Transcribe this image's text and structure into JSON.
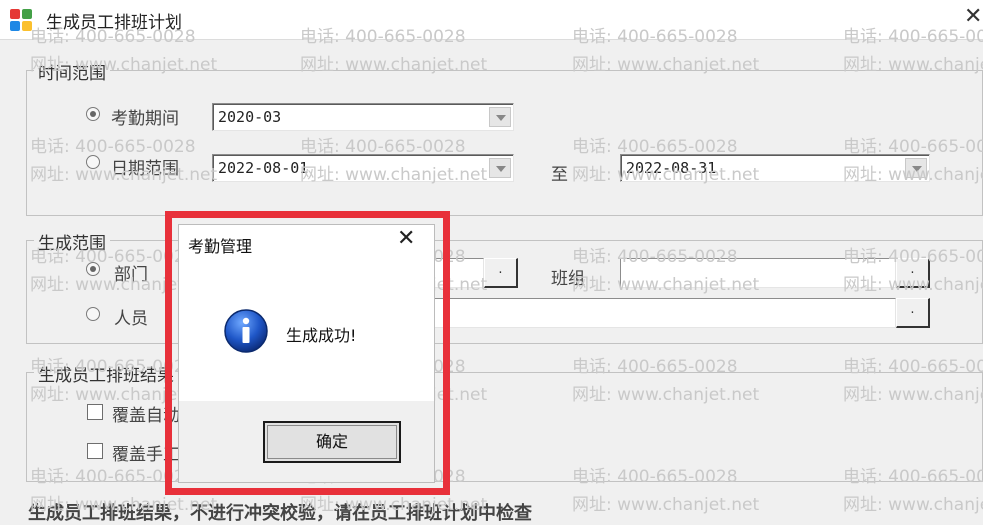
{
  "window": {
    "title": "生成员工排班计划",
    "icon": "app-grid-icon",
    "icon_colors": [
      "#e53935",
      "#43a047",
      "#1e88e5",
      "#fbc02d"
    ]
  },
  "watermark": {
    "phone": "电话: 400-665-0028",
    "site": "网址: www.chanjet.net"
  },
  "time_range": {
    "legend": "时间范围",
    "attendance_period": {
      "label": "考勤期间",
      "value": "2020-03",
      "selected": true
    },
    "date_range": {
      "label": "日期范围",
      "start": "2022-08-01",
      "to_label": "至",
      "end": "2022-08-31",
      "selected": false
    }
  },
  "scope": {
    "legend": "生成范围",
    "department": {
      "label": "部门",
      "selected": true
    },
    "team_label": "班组",
    "person": {
      "label": "人员",
      "selected": false
    },
    "browse_glyph": "."
  },
  "result": {
    "legend": "生成员工排班结果",
    "overwrite_auto": "覆盖自动",
    "overwrite_manual": "覆盖手工"
  },
  "footer_note": "生成员工排班结果，不进行冲突校验，请在员工排班计划中检查",
  "dialog": {
    "title": "考勤管理",
    "icon": "info-icon",
    "message": "生成成功!",
    "ok_label": "确定",
    "highlight_color": "#e8303a"
  }
}
